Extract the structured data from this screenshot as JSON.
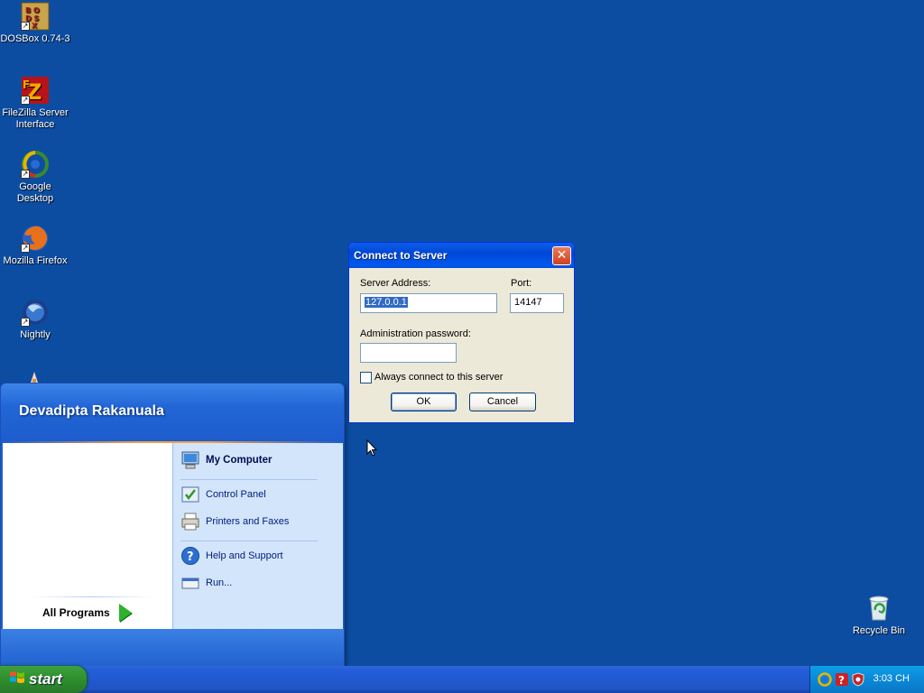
{
  "desktop": {
    "icons": [
      {
        "label": "DOSBox 0.74-3",
        "icon": "dosbox-icon"
      },
      {
        "label": "FileZilla Server Interface",
        "icon": "filezilla-icon"
      },
      {
        "label": "Google Desktop",
        "icon": "google-desktop-icon"
      },
      {
        "label": "Mozilla Firefox",
        "icon": "firefox-icon"
      },
      {
        "label": "Nightly",
        "icon": "nightly-icon"
      },
      {
        "label": "Recycle Bin",
        "icon": "recycle-bin-icon"
      }
    ]
  },
  "start_menu": {
    "user_name": "Devadipta Rakanuala",
    "all_programs_label": "All Programs",
    "right_items": [
      {
        "label": "My Computer",
        "icon": "my-computer-icon"
      },
      {
        "label": "Control Panel",
        "icon": "control-panel-icon"
      },
      {
        "label": "Printers and Faxes",
        "icon": "printer-icon"
      },
      {
        "label": "Help and Support",
        "icon": "help-icon"
      },
      {
        "label": "Run...",
        "icon": "run-icon"
      }
    ]
  },
  "dialog": {
    "title": "Connect to Server",
    "server_address_label": "Server Address:",
    "server_address_value": "127.0.0.1",
    "port_label": "Port:",
    "port_value": "14147",
    "password_label": "Administration password:",
    "password_value": "",
    "always_connect_label": "Always connect to this server",
    "always_connect_checked": false,
    "ok_label": "OK",
    "cancel_label": "Cancel",
    "close_glyph": "✕"
  },
  "taskbar": {
    "start_label": "start",
    "clock": "3:03 CH"
  },
  "colors": {
    "desktop": "#0c4da2",
    "title_bar": "#0054e3",
    "start_button": "#2e8f2e",
    "tray": "#0b88d6"
  }
}
